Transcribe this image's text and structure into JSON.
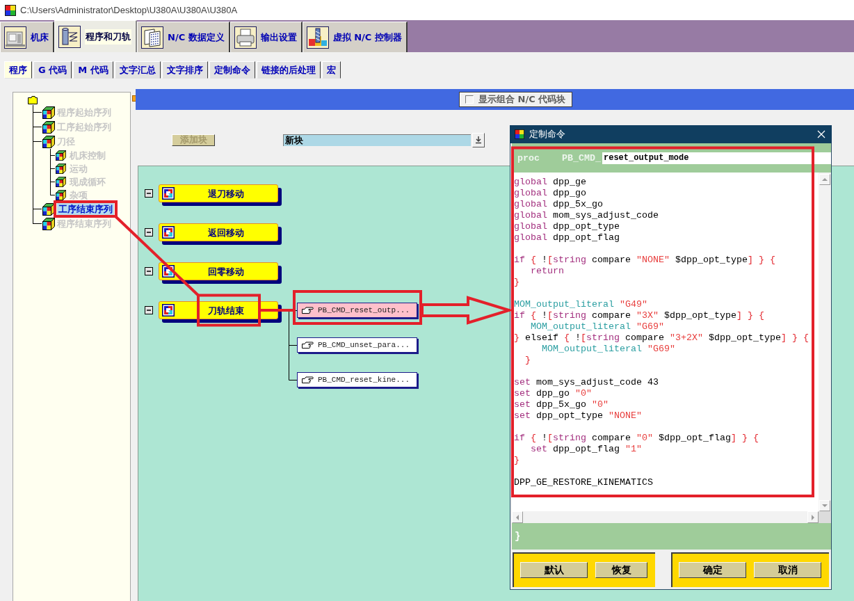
{
  "window": {
    "title": "C:\\Users\\Administrator\\Desktop\\U380A\\U380A\\U380A"
  },
  "main_tabs": [
    {
      "label": "机床",
      "selected": false
    },
    {
      "label": "程序和刀轨",
      "selected": true
    },
    {
      "label": "N/C 数据定义",
      "selected": false
    },
    {
      "label": "输出设置",
      "selected": false
    },
    {
      "label": "虚拟 N/C 控制器",
      "selected": false
    }
  ],
  "sub_tabs": [
    {
      "label": "程序",
      "selected": true
    },
    {
      "label": "G 代码",
      "selected": false
    },
    {
      "label": "M 代码",
      "selected": false
    },
    {
      "label": "文字汇总",
      "selected": false
    },
    {
      "label": "文字排序",
      "selected": false
    },
    {
      "label": "定制命令",
      "selected": false
    },
    {
      "label": "链接的后处理",
      "selected": false
    },
    {
      "label": "宏",
      "selected": false
    }
  ],
  "tree": {
    "items": [
      {
        "label": "程序起始序列",
        "selected": false,
        "annotated": false
      },
      {
        "label": "工序起始序列",
        "selected": false,
        "annotated": false
      },
      {
        "label": "刀径",
        "selected": false,
        "annotated": false,
        "children": [
          {
            "label": "机床控制",
            "selected": false,
            "annotated": false
          },
          {
            "label": "运动",
            "selected": false,
            "annotated": false
          },
          {
            "label": "现成循环",
            "selected": false,
            "annotated": false
          },
          {
            "label": "杂项",
            "selected": false,
            "annotated": false
          }
        ]
      },
      {
        "label": "工序结束序列",
        "selected": true,
        "annotated": true
      },
      {
        "label": "程序结束序列",
        "selected": false,
        "annotated": false
      }
    ]
  },
  "header": {
    "checkbox": {
      "label": "显示组合 N/C 代码块",
      "checked": false
    }
  },
  "toolbar": {
    "add_button": {
      "label": "添加块",
      "disabled": true
    },
    "block_select": {
      "value": "新块"
    }
  },
  "canvas": {
    "blocks": [
      {
        "label": "退刀移动",
        "expanded": true,
        "annotated": false
      },
      {
        "label": "返回移动",
        "expanded": true,
        "annotated": false
      },
      {
        "label": "回零移动",
        "expanded": true,
        "annotated": false
      },
      {
        "label": "刀轨结束",
        "expanded": true,
        "annotated": true,
        "commands": [
          {
            "label": "PB_CMD_reset_outp...",
            "selected": true,
            "annotated": true
          },
          {
            "label": "PB_CMD_unset_para...",
            "selected": false,
            "annotated": false
          },
          {
            "label": "PB_CMD_reset_kine...",
            "selected": false,
            "annotated": false
          }
        ]
      }
    ]
  },
  "dialog": {
    "title": "定制命令",
    "proc_label": "proc",
    "name_prefix": "PB_CMD_",
    "name_value": "reset_output_mode",
    "annotated": true,
    "lines": [
      {
        "kind": "code",
        "tokens": [
          {
            "kind": "keyword",
            "text": "global"
          },
          {
            "kind": "plain",
            "text": " dpp_ge"
          }
        ]
      },
      {
        "kind": "code",
        "tokens": [
          {
            "kind": "keyword",
            "text": "global"
          },
          {
            "kind": "plain",
            "text": " dpp_go"
          }
        ]
      },
      {
        "kind": "code",
        "tokens": [
          {
            "kind": "keyword",
            "text": "global"
          },
          {
            "kind": "plain",
            "text": " dpp_5x_go"
          }
        ]
      },
      {
        "kind": "code",
        "tokens": [
          {
            "kind": "keyword",
            "text": "global"
          },
          {
            "kind": "plain",
            "text": " mom_sys_adjust_code"
          }
        ]
      },
      {
        "kind": "code",
        "tokens": [
          {
            "kind": "keyword",
            "text": "global"
          },
          {
            "kind": "plain",
            "text": " dpp_opt_type"
          }
        ]
      },
      {
        "kind": "code",
        "tokens": [
          {
            "kind": "keyword",
            "text": "global"
          },
          {
            "kind": "plain",
            "text": " dpp_opt_flag"
          }
        ]
      },
      {
        "kind": "blank"
      },
      {
        "kind": "code",
        "tokens": [
          {
            "kind": "keyword",
            "text": "if"
          },
          {
            "kind": "brace",
            "text": " {"
          },
          {
            "kind": "plain",
            "text": " !"
          },
          {
            "kind": "brace",
            "text": "["
          },
          {
            "kind": "keyword",
            "text": "string"
          },
          {
            "kind": "plain",
            "text": " compare "
          },
          {
            "kind": "string",
            "text": "\"NONE\""
          },
          {
            "kind": "plain",
            "text": " $dpp_opt_type"
          },
          {
            "kind": "brace",
            "text": "] } {"
          }
        ]
      },
      {
        "kind": "code",
        "tokens": [
          {
            "kind": "keyword",
            "text": "   return"
          }
        ]
      },
      {
        "kind": "code",
        "tokens": [
          {
            "kind": "brace",
            "text": "}"
          }
        ]
      },
      {
        "kind": "blank"
      },
      {
        "kind": "code",
        "tokens": [
          {
            "kind": "command",
            "text": "MOM_output_literal"
          },
          {
            "kind": "string",
            "text": " \"G49\""
          }
        ]
      },
      {
        "kind": "code",
        "tokens": [
          {
            "kind": "keyword",
            "text": "if"
          },
          {
            "kind": "brace",
            "text": " {"
          },
          {
            "kind": "plain",
            "text": " !"
          },
          {
            "kind": "brace",
            "text": "["
          },
          {
            "kind": "keyword",
            "text": "string"
          },
          {
            "kind": "plain",
            "text": " compare "
          },
          {
            "kind": "string",
            "text": "\"3X\""
          },
          {
            "kind": "plain",
            "text": " $dpp_opt_type"
          },
          {
            "kind": "brace",
            "text": "] } {"
          }
        ]
      },
      {
        "kind": "code",
        "tokens": [
          {
            "kind": "command",
            "text": "   MOM_output_literal"
          },
          {
            "kind": "string",
            "text": " \"G69\""
          }
        ]
      },
      {
        "kind": "code",
        "tokens": [
          {
            "kind": "brace",
            "text": "}"
          },
          {
            "kind": "plain",
            "text": " elseif"
          },
          {
            "kind": "brace",
            "text": " {"
          },
          {
            "kind": "plain",
            "text": " !"
          },
          {
            "kind": "brace",
            "text": "["
          },
          {
            "kind": "keyword",
            "text": "string"
          },
          {
            "kind": "plain",
            "text": " compare "
          },
          {
            "kind": "string",
            "text": "\"3+2X\""
          },
          {
            "kind": "plain",
            "text": " $dpp_opt_type"
          },
          {
            "kind": "brace",
            "text": "] } {"
          }
        ]
      },
      {
        "kind": "code",
        "tokens": [
          {
            "kind": "command",
            "text": "     MOM_output_literal"
          },
          {
            "kind": "string",
            "text": " \"G69\""
          }
        ]
      },
      {
        "kind": "code",
        "tokens": [
          {
            "kind": "brace",
            "text": "  }"
          }
        ]
      },
      {
        "kind": "blank"
      },
      {
        "kind": "code",
        "tokens": [
          {
            "kind": "keyword",
            "text": "set"
          },
          {
            "kind": "plain",
            "text": " mom_sys_adjust_code 43"
          }
        ]
      },
      {
        "kind": "code",
        "tokens": [
          {
            "kind": "keyword",
            "text": "set"
          },
          {
            "kind": "plain",
            "text": " dpp_go"
          },
          {
            "kind": "string",
            "text": " \"0\""
          }
        ]
      },
      {
        "kind": "code",
        "tokens": [
          {
            "kind": "keyword",
            "text": "set"
          },
          {
            "kind": "plain",
            "text": " dpp_5x_go"
          },
          {
            "kind": "string",
            "text": " \"0\""
          }
        ]
      },
      {
        "kind": "code",
        "tokens": [
          {
            "kind": "keyword",
            "text": "set"
          },
          {
            "kind": "plain",
            "text": " dpp_opt_type"
          },
          {
            "kind": "string",
            "text": " \"NONE\""
          }
        ]
      },
      {
        "kind": "blank"
      },
      {
        "kind": "code",
        "tokens": [
          {
            "kind": "keyword",
            "text": "if"
          },
          {
            "kind": "brace",
            "text": " {"
          },
          {
            "kind": "plain",
            "text": " !"
          },
          {
            "kind": "brace",
            "text": "["
          },
          {
            "kind": "keyword",
            "text": "string"
          },
          {
            "kind": "plain",
            "text": " compare "
          },
          {
            "kind": "string",
            "text": "\"0\""
          },
          {
            "kind": "plain",
            "text": " $dpp_opt_flag"
          },
          {
            "kind": "brace",
            "text": "] } {"
          }
        ]
      },
      {
        "kind": "code",
        "tokens": [
          {
            "kind": "keyword",
            "text": "   set"
          },
          {
            "kind": "plain",
            "text": " dpp_opt_flag"
          },
          {
            "kind": "string",
            "text": " \"1\""
          }
        ]
      },
      {
        "kind": "code",
        "tokens": [
          {
            "kind": "brace",
            "text": "}"
          }
        ]
      },
      {
        "kind": "blank"
      },
      {
        "kind": "code",
        "tokens": [
          {
            "kind": "plain",
            "text": "DPP_GE_RESTORE_KINEMATICS"
          }
        ]
      }
    ],
    "closing": "}",
    "button_groups": [
      {
        "buttons": [
          {
            "label": "默认"
          },
          {
            "label": "恢复"
          }
        ]
      },
      {
        "buttons": [
          {
            "label": "确定"
          },
          {
            "label": "取消"
          }
        ]
      }
    ]
  },
  "annotation_links": [
    {
      "kind": "line"
    },
    {
      "kind": "line"
    },
    {
      "kind": "arrow"
    }
  ]
}
